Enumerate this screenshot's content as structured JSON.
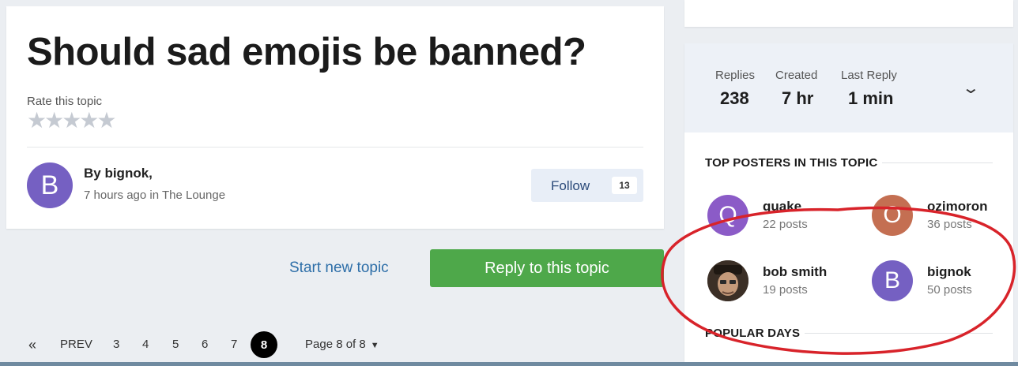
{
  "topic": {
    "title": "Should sad emojis be banned?",
    "rate_label": "Rate this topic",
    "stars": "★★★★★",
    "author": {
      "initial": "B",
      "byline": "By bignok,",
      "meta": "7 hours ago in The Lounge",
      "avatar_color": "#7560c2"
    },
    "follow": {
      "label": "Follow",
      "count": "13"
    }
  },
  "actions": {
    "start_topic": "Start new topic",
    "reply": "Reply to this topic"
  },
  "pagination": {
    "first_icon": "«",
    "prev": "PREV",
    "pages": [
      "3",
      "4",
      "5",
      "6",
      "7"
    ],
    "current": "8",
    "jump_label": "Page 8 of 8",
    "jump_caret": "▼"
  },
  "sidebar": {
    "stats": [
      {
        "label": "Replies",
        "value": "238"
      },
      {
        "label": "Created",
        "value": "7 hr"
      },
      {
        "label": "Last Reply",
        "value": "1 min"
      }
    ],
    "expand_icon": "⌄",
    "top_posters_title": "TOP POSTERS IN THIS TOPIC",
    "posters": [
      {
        "name": "quake",
        "count": "22 posts",
        "initial": "Q",
        "color": "#8b5bc7"
      },
      {
        "name": "ozimoron",
        "count": "36 posts",
        "initial": "O",
        "color": "#c46f52"
      },
      {
        "name": "bob smith",
        "count": "19 posts",
        "initial": "",
        "color": "#5b4636"
      },
      {
        "name": "bignok",
        "count": "50 posts",
        "initial": "B",
        "color": "#7560c2"
      }
    ],
    "popular_days_title": "POPULAR DAYS"
  },
  "colors": {
    "accent_green": "#4ea84a",
    "link_blue": "#2d6ea8",
    "annotation_red": "#d8232a"
  }
}
